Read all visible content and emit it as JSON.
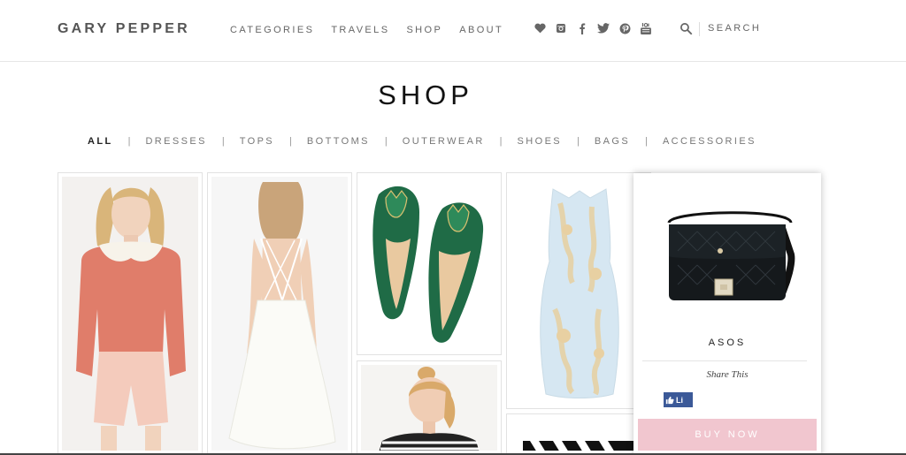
{
  "header": {
    "logo": "GARY PEPPER",
    "nav": [
      "CATEGORIES",
      "TRAVELS",
      "SHOP",
      "ABOUT"
    ],
    "social_icons": [
      "heart-icon",
      "instagram-icon",
      "facebook-icon",
      "twitter-icon",
      "pinterest-icon",
      "youtube-icon"
    ],
    "search_placeholder": "SEARCH"
  },
  "page": {
    "title": "SHOP",
    "filters": [
      "ALL",
      "DRESSES",
      "TOPS",
      "BOTTOMS",
      "OUTERWEAR",
      "SHOES",
      "BAGS",
      "ACCESSORIES"
    ],
    "filter_separator": "|",
    "active_filter": "ALL"
  },
  "popup": {
    "brand": "ASOS",
    "share_label": "Share This",
    "like_label": "Li",
    "buy_label": "BUY NOW"
  },
  "colors": {
    "buy_button": "#f1c6cf",
    "facebook": "#3b5998"
  }
}
